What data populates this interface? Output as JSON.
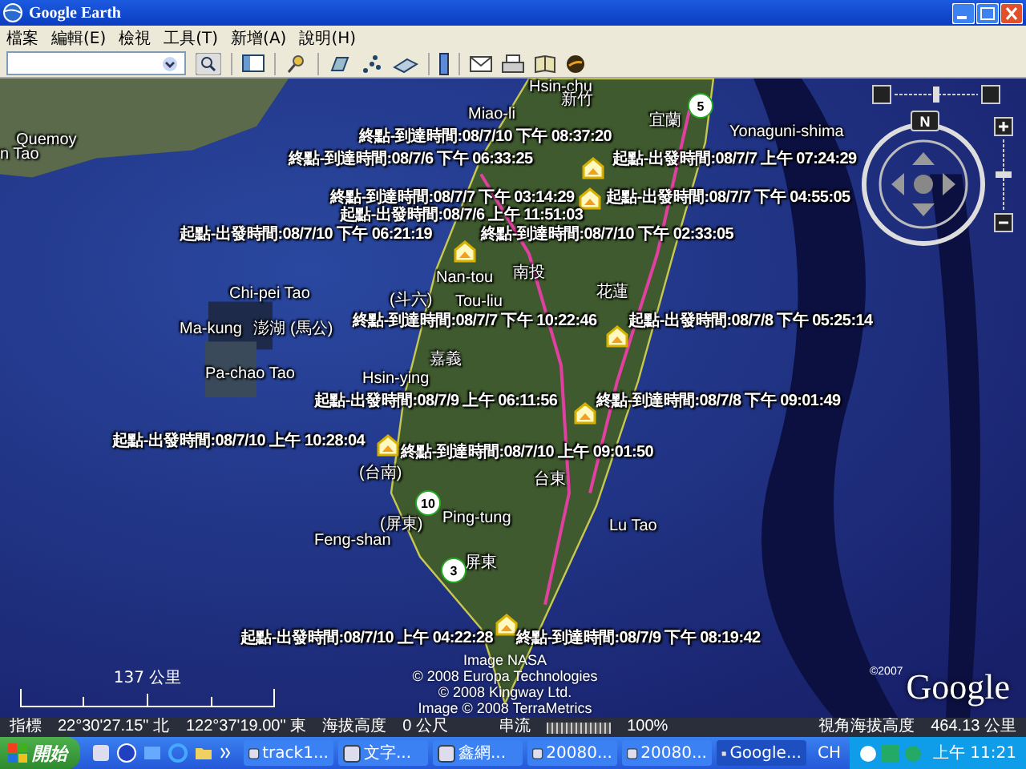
{
  "window": {
    "title": "Google Earth"
  },
  "menu": [
    {
      "label": "檔案"
    },
    {
      "label": "編輯(E)"
    },
    {
      "label": "檢視"
    },
    {
      "label": "工具(T)"
    },
    {
      "label": "新增(A)"
    },
    {
      "label": "說明(H)"
    }
  ],
  "map": {
    "places": [
      {
        "text": "Hsin-chu"
      },
      {
        "text": "新竹"
      },
      {
        "text": "Miao-li"
      },
      {
        "text": "宜蘭"
      },
      {
        "text": "Quemoy"
      },
      {
        "text": "n Tao"
      },
      {
        "text": "Yonaguni-shima"
      },
      {
        "text": "Nan-tou"
      },
      {
        "text": "南投"
      },
      {
        "text": "花蓮"
      },
      {
        "text": "Chi-pei Tao"
      },
      {
        "text": "(斗六)"
      },
      {
        "text": "Tou-liu"
      },
      {
        "text": "Ma-kung"
      },
      {
        "text": "澎湖"
      },
      {
        "text": "(馬公)"
      },
      {
        "text": "嘉義"
      },
      {
        "text": "Pa-chao Tao"
      },
      {
        "text": "Hsin-ying"
      },
      {
        "text": "(台南)"
      },
      {
        "text": "台東"
      },
      {
        "text": "(屏東)"
      },
      {
        "text": "Ping-tung"
      },
      {
        "text": "Feng-shan"
      },
      {
        "text": "Lu Tao"
      },
      {
        "text": "屏東"
      }
    ],
    "time_labels": [
      {
        "text": "終點-到達時間:08/7/10 下午 08:37:20"
      },
      {
        "text": "終點-到達時間:08/7/6 下午 06:33:25"
      },
      {
        "text": "起點-出發時間:08/7/7 上午 07:24:29"
      },
      {
        "text": "終點-到達時間:08/7/7 下午 03:14:29"
      },
      {
        "text": "起點-出發時間:08/7/7 下午 04:55:05"
      },
      {
        "text": "起點-出發時間:08/7/6 上午 11:51:03"
      },
      {
        "text": "起點-出發時間:08/7/10 下午 06:21:19"
      },
      {
        "text": "終點-到達時間:08/7/10 下午 02:33:05"
      },
      {
        "text": "終點-到達時間:08/7/7 下午 10:22:46"
      },
      {
        "text": "起點-出發時間:08/7/8 下午 05:25:14"
      },
      {
        "text": "起點-出發時間:08/7/9 上午 06:11:56"
      },
      {
        "text": "終點-到達時間:08/7/8 下午 09:01:49"
      },
      {
        "text": "起點-出發時間:08/7/10 上午 10:28:04"
      },
      {
        "text": "終點-到達時間:08/7/10 上午 09:01:50"
      },
      {
        "text": "起點-出發時間:08/7/10 上午 04:22:28"
      },
      {
        "text": "終點-到達時間:08/7/9 下午 08:19:42"
      }
    ],
    "shields": [
      {
        "text": "5"
      },
      {
        "text": "10"
      },
      {
        "text": "3"
      }
    ],
    "attribution": [
      "Image NASA",
      "© 2008 Europa Technologies",
      "© 2008 Kingway Ltd.",
      "Image © 2008 TerraMetrics"
    ],
    "scale": "137 公里",
    "logo": {
      "copyright": "©2007",
      "text": "Google"
    },
    "navigation": {
      "north": "N"
    }
  },
  "status_bar": {
    "pointer_label": "指標",
    "latitude": "22°30'27.15\" 北",
    "longitude": "122°37'19.00\" 東",
    "elevation_label": "海拔高度",
    "elevation": "0 公尺",
    "streaming_label": "串流",
    "streaming": {
      "level": 1
    },
    "streaming_percent": "100%",
    "eye_alt_label": "視角海拔高度",
    "eye_alt": "464.13 公里"
  },
  "taskbar": {
    "start": "開始",
    "tasks": [
      {
        "label": "track1...",
        "selected": false
      },
      {
        "label": "文字...",
        "selected": false
      },
      {
        "label": "鑫網...",
        "selected": false
      },
      {
        "label": "20080...",
        "selected": false
      },
      {
        "label": "20080...",
        "selected": false
      },
      {
        "label": "Google...",
        "selected": true
      }
    ],
    "language": "CH",
    "clock": "上午 11:21"
  }
}
